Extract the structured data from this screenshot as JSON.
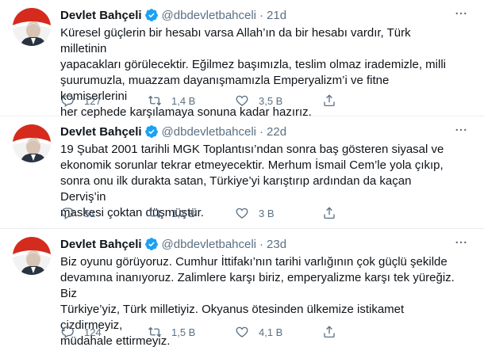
{
  "tweets": [
    {
      "name": "Devlet Bahçeli",
      "handle": "@dbdevletbahceli",
      "dot": "·",
      "time": "21d",
      "text": "Küresel güçlerin bir hesabı varsa Allah’ın da bir hesabı vardır, Türk milletinin\nyapacakları görülecektir. Eğilmez başımızla, teslim olmaz irademizle, milli\nşuurumuzla, muazzam dayanışmamızla Emperyalizm’i ve fitne komiserlerini\nher cephede karşılamaya sonuna kadar hazırız.",
      "replies": "127",
      "retweets": "1,4 B",
      "likes": "3,5 B"
    },
    {
      "name": "Devlet Bahçeli",
      "handle": "@dbdevletbahceli",
      "dot": "·",
      "time": "22d",
      "text": "19 Şubat 2001 tarihli MGK Toplantısı’ndan sonra baş gösteren siyasal ve\nekonomik sorunlar tekrar etmeyecektir. Merhum İsmail Cem’le yola çıkıp,\nsonra onu ilk durakta satan, Türkiye’yi karıştırıp ardından da kaçan Derviş’in\nmaskesi çoktan düşmüştür.",
      "replies": "51",
      "retweets": "1,2 B",
      "likes": "3 B"
    },
    {
      "name": "Devlet Bahçeli",
      "handle": "@dbdevletbahceli",
      "dot": "·",
      "time": "23d",
      "text": "Biz oyunu görüyoruz. Cumhur İttifakı’nın tarihi varlığının çok güçlü şekilde\ndevamına inanıyoruz. Zalimlere karşı biriz, emperyalizme karşı tek yüreğiz. Biz\nTürkiye’yiz, Türk milletiyiz. Okyanus ötesinden ülkemize istikamet çizdirmeyiz,\nmüdahale ettirmeyiz.",
      "replies": "124",
      "retweets": "1,5 B",
      "likes": "4,1 B"
    }
  ],
  "colors": {
    "verified": "#1da1f2",
    "muted": "#5b7083",
    "divider": "#ebeef0",
    "flag_red": "#d52b1e"
  },
  "icons": {
    "verified": "verified-badge-icon",
    "more": "more-dots-icon",
    "reply": "reply-bubble-icon",
    "retweet": "retweet-arrows-icon",
    "like": "heart-icon",
    "share": "share-upload-icon"
  }
}
